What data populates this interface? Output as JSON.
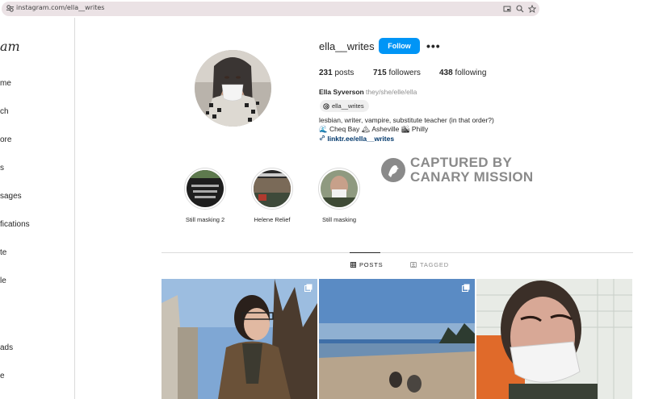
{
  "browser": {
    "url": "instagram.com/ella__writes"
  },
  "sidebar": {
    "logo": "am",
    "items": [
      {
        "label": "me"
      },
      {
        "label": "ch"
      },
      {
        "label": "ore"
      },
      {
        "label": "s"
      },
      {
        "label": "sages"
      },
      {
        "label": "fications"
      },
      {
        "label": "te"
      },
      {
        "label": "le"
      },
      {
        "label": "ads"
      },
      {
        "label": "e"
      }
    ]
  },
  "profile": {
    "username": "ella__writes",
    "follow_label": "Follow",
    "more_label": "•••",
    "posts_count": "231",
    "posts_label": "posts",
    "followers_count": "715",
    "followers_label": "followers",
    "following_count": "438",
    "following_label": "following",
    "full_name": "Ella Syverson",
    "pronouns": "they/she/elle/ella",
    "threads_handle": "ella__writes",
    "bio_line1": "lesbian, writer, vampire, substitute teacher (in that order?)",
    "bio_line2_a": "🌊 Cheq Bay",
    "bio_line2_b": "🏔 Asheville",
    "bio_line2_c": "🏙 Philly",
    "link": "linktr.ee/ella__writes"
  },
  "watermark": {
    "line1": "CAPTURED BY",
    "line2": "CANARY MISSION"
  },
  "highlights": [
    {
      "label": "Still masking 2"
    },
    {
      "label": "Helene Relief"
    },
    {
      "label": "Still masking"
    }
  ],
  "tabs": {
    "posts": "POSTS",
    "tagged": "TAGGED"
  },
  "colors": {
    "follow_blue": "#0095f6",
    "link_blue": "#00376b",
    "watermark_gray": "#8a8a8a"
  }
}
